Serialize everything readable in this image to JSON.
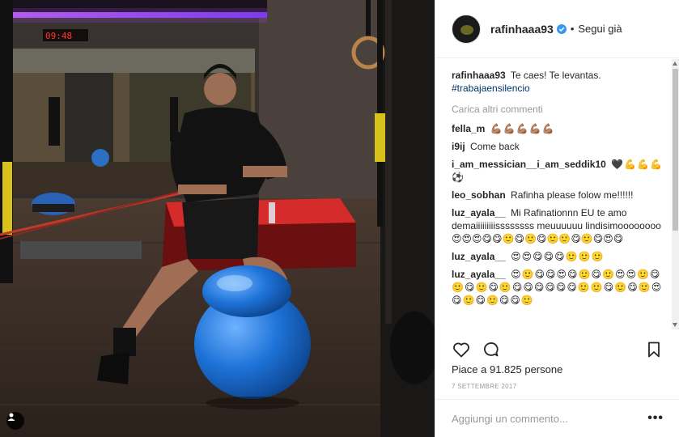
{
  "header": {
    "username": "rafinhaaa93",
    "follow_status": "Segui già",
    "separator": "•"
  },
  "caption": {
    "username": "rafinhaaa93",
    "text": "Te caes! Te levantas.",
    "hashtag": "#trabajaensilencio"
  },
  "load_more": "Carica altri commenti",
  "comments": [
    {
      "username": "fella_m",
      "text": "💪🏽💪🏽💪🏽💪🏽💪🏽"
    },
    {
      "username": "i9ij",
      "text": "Come back"
    },
    {
      "username": "i_am_messician__i_am_seddik10",
      "text": "🖤💪💪💪⚽"
    },
    {
      "username": "leo_sobhan",
      "text": "Rafinha please folow me!!!!!!"
    },
    {
      "username": "luz_ayala__",
      "text": "Mi Rafinationnn EU te amo demaiiiiiiiiissssssss meuuuuuu lindisimoooooooo😍😍😍😋😋🙂😋🙂😋🙂🙂😋🙂😋😍😋"
    },
    {
      "username": "luz_ayala__",
      "text": "😍😍😋😋😋🙂🙂🙂"
    },
    {
      "username": "luz_ayala__",
      "text": "😍🙂😋😋😍😋🙂😋🙂😍😍🙂😋🙂😋🙂😋🙂😋😋😋😋😋😋🙂🙂😋🙂😋🙂😍😋🙂😋🙂😋😋🙂"
    }
  ],
  "stats": {
    "likes": "Piace a 91.825 persone",
    "date": "7 SETTEMBRE 2017"
  },
  "composer": {
    "placeholder": "Aggiungi un commento...",
    "options": "•••"
  },
  "photo": {
    "timer": "09:48"
  },
  "icons": {
    "like": "heart-icon",
    "comment": "comment-bubble-icon",
    "save": "bookmark-icon",
    "tag": "user-tag-icon",
    "verified": "verified-badge-icon"
  },
  "colors": {
    "link": "#003569",
    "verified": "#3897f0",
    "muted": "#999999",
    "neon": "#b84dff",
    "ball": "#1e73d8"
  }
}
